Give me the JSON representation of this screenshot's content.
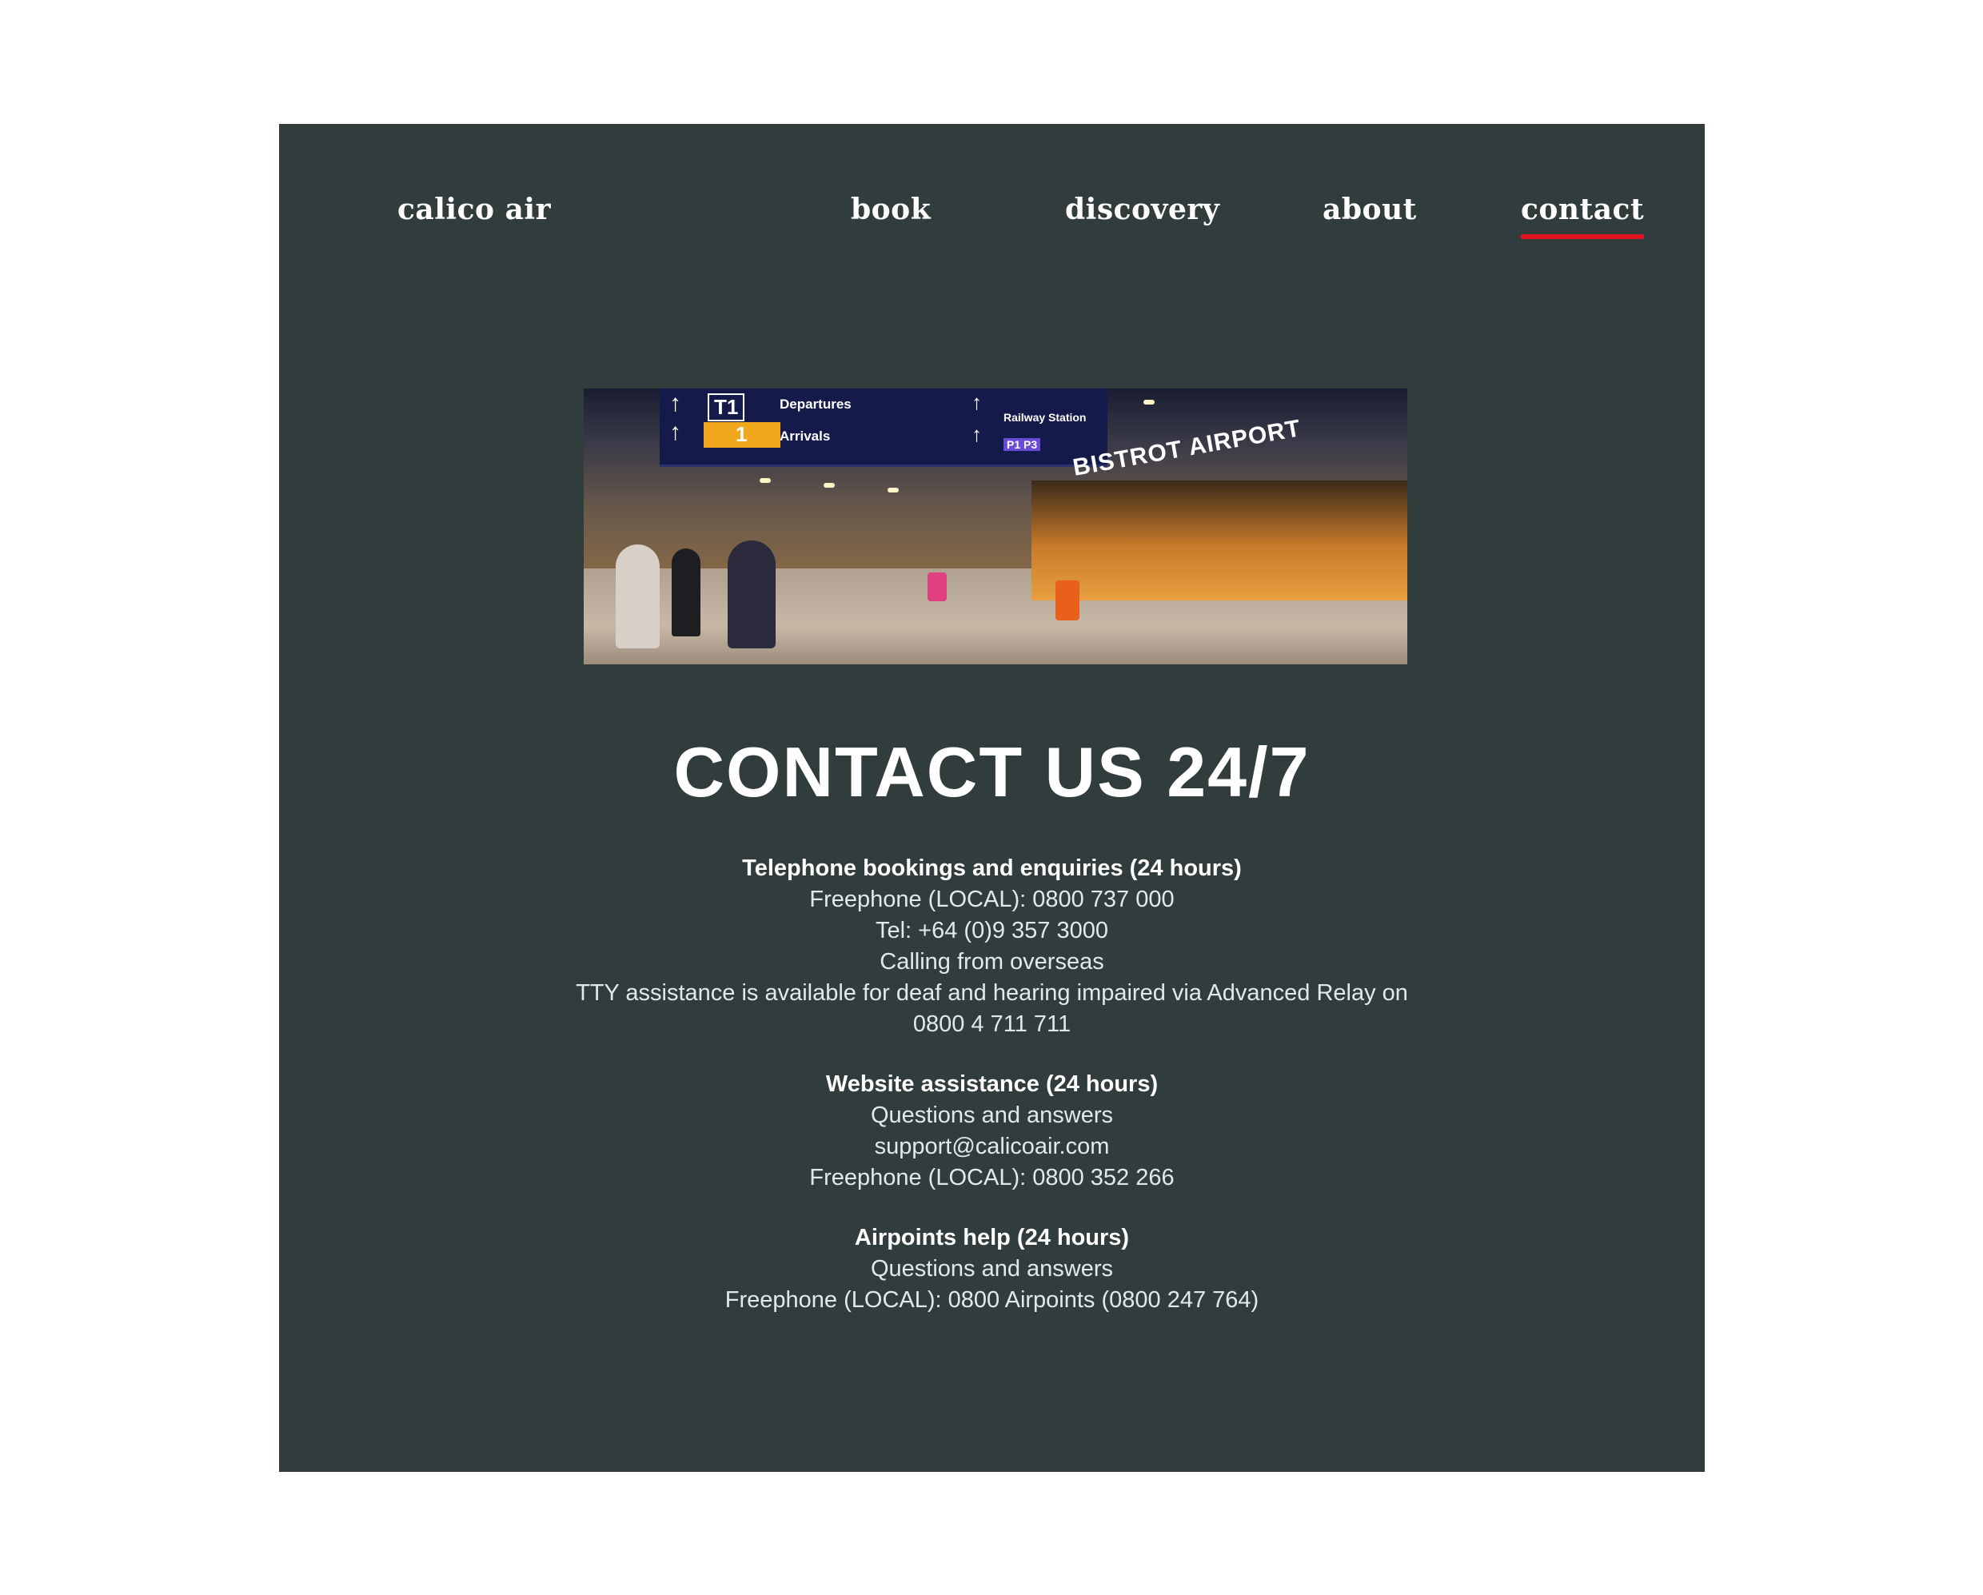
{
  "nav": {
    "brand": "calico air",
    "items": [
      {
        "label": "book"
      },
      {
        "label": "discovery"
      },
      {
        "label": "about"
      },
      {
        "label": "contact",
        "active": true
      }
    ],
    "active_color": "#e0161e"
  },
  "theme": {
    "panel_bg": "#313d3d",
    "page_bg": "#ffffff"
  },
  "hero_image": {
    "description_icon": "airport-terminal-photo",
    "sign_text": {
      "t1": "T1",
      "departures": "Departures",
      "arrivals": "Arrivals",
      "one": "1",
      "railway": "Railway Station",
      "p": "P1 P3",
      "shop": "BISTROT AIRPORT"
    }
  },
  "main": {
    "heading": "CONTACT US 24/7",
    "telephone": {
      "title": "Telephone bookings and enquiries (24 hours)",
      "freephone": "Freephone (LOCAL): 0800 737 000",
      "tel": "Tel: +64 (0)9 357 3000",
      "overseas": "Calling from overseas",
      "tty_line1": "TTY assistance is available for deaf and hearing impaired via Advanced Relay on",
      "tty_line2": "0800 4 711 711"
    },
    "website": {
      "title": "Website assistance (24 hours)",
      "qa": "Questions and answers",
      "email": "support@calicoair.com",
      "freephone": "Freephone (LOCAL): 0800 352 266"
    },
    "airpoints": {
      "title": "Airpoints help (24 hours)",
      "qa": "Questions and answers",
      "freephone": "Freephone (LOCAL): 0800 Airpoints (0800 247 764)"
    }
  }
}
